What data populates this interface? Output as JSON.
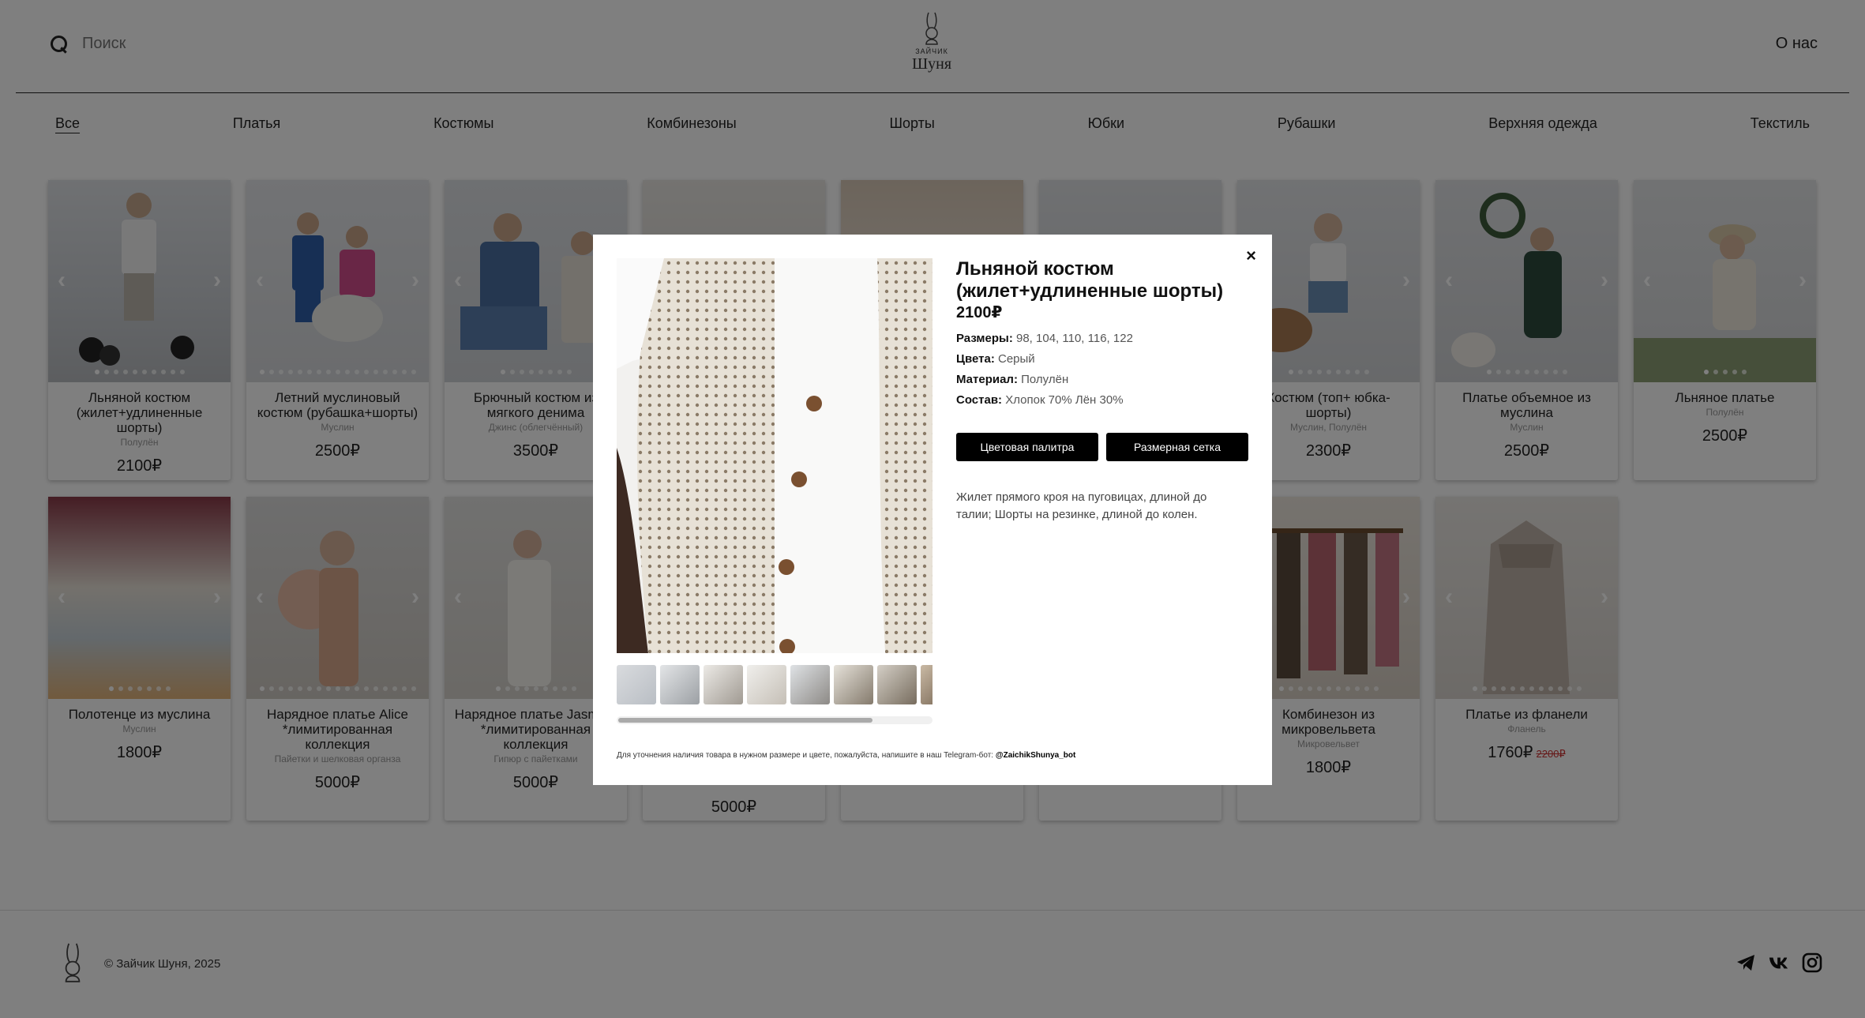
{
  "header": {
    "search_placeholder": "Поиск",
    "logo_small": "ЗАЙЧИК",
    "logo_name": "Шуня",
    "about": "О нас"
  },
  "categories": [
    "Все",
    "Платья",
    "Костюмы",
    "Комбинезоны",
    "Шорты",
    "Юбки",
    "Рубашки",
    "Верхняя одежда",
    "Текстиль"
  ],
  "products_row1": [
    {
      "title": "Льняной костюм (жилет+удлиненные шорты)",
      "material": "Полулён",
      "price": "2100₽"
    },
    {
      "title": "Летний муслиновый костюм (рубашка+шорты)",
      "material": "Муслин",
      "price": "2500₽"
    },
    {
      "title": "Брючный костюм из мягкого денима",
      "material": "Джинс (облегчённый)",
      "price": "3500₽"
    },
    {
      "title": "",
      "material": "",
      "price": ""
    },
    {
      "title": "",
      "material": "",
      "price": ""
    },
    {
      "title": "",
      "material": "",
      "price": ""
    },
    {
      "title": "Костюм (топ+ юбка-шорты)",
      "material": "Муслин, Полулён",
      "price": "2300₽"
    },
    {
      "title": "Платье объемное из муслина",
      "material": "Муслин",
      "price": "2500₽"
    },
    {
      "title": "Льняное платье",
      "material": "Полулён",
      "price": "2500₽"
    }
  ],
  "products_row2": [
    {
      "title": "Полотенце из муслина",
      "material": "Муслин",
      "price": "1800₽"
    },
    {
      "title": "Нарядное платье Alice *лимитированная коллекция",
      "material": "Пайетки и шелковая органза",
      "price": "5000₽"
    },
    {
      "title": "Нарядное платье Jasmine *лимитированная коллекция",
      "material": "Гипюр с пайетками",
      "price": "5000₽"
    },
    {
      "title": "",
      "material": "",
      "price": "5000₽"
    },
    {
      "title": "",
      "material": "",
      "price": ""
    },
    {
      "title": "",
      "material": "",
      "price": ""
    },
    {
      "title": "Комбинезон из микровельвета",
      "material": "Микровельвет",
      "price": "1800₽"
    },
    {
      "title": "Платье из фланели",
      "material": "Фланель",
      "price": "1760₽",
      "old_price": "2200₽"
    }
  ],
  "modal": {
    "close": "×",
    "title": "Льняной костюм (жилет+удлиненные шорты)",
    "price": "2100₽",
    "sizes_label": "Размеры:",
    "sizes": "98, 104, 110, 116, 122",
    "colors_label": "Цвета:",
    "colors": "Серый",
    "material_label": "Материал:",
    "material": "Полулён",
    "composition_label": "Состав:",
    "composition": "Хлопок 70% Лён 30%",
    "btn_palette": "Цветовая палитра",
    "btn_size_chart": "Размерная сетка",
    "description": "Жилет прямого кроя на пуговицах, длиной до талии; Шорты на резинке, длиной до колен.",
    "note": "Для уточнения наличия товара в нужном размере и цвете, пожалуйста, напишите в наш Telegram-бот:",
    "bot": "@ZaichikShunya_bot"
  },
  "footer": {
    "copyright": "© Зайчик Шуня, 2025"
  },
  "colors": {
    "overlay": "rgba(0,0,0,0.5)",
    "button": "#000000",
    "old_price": "#cc3333"
  }
}
